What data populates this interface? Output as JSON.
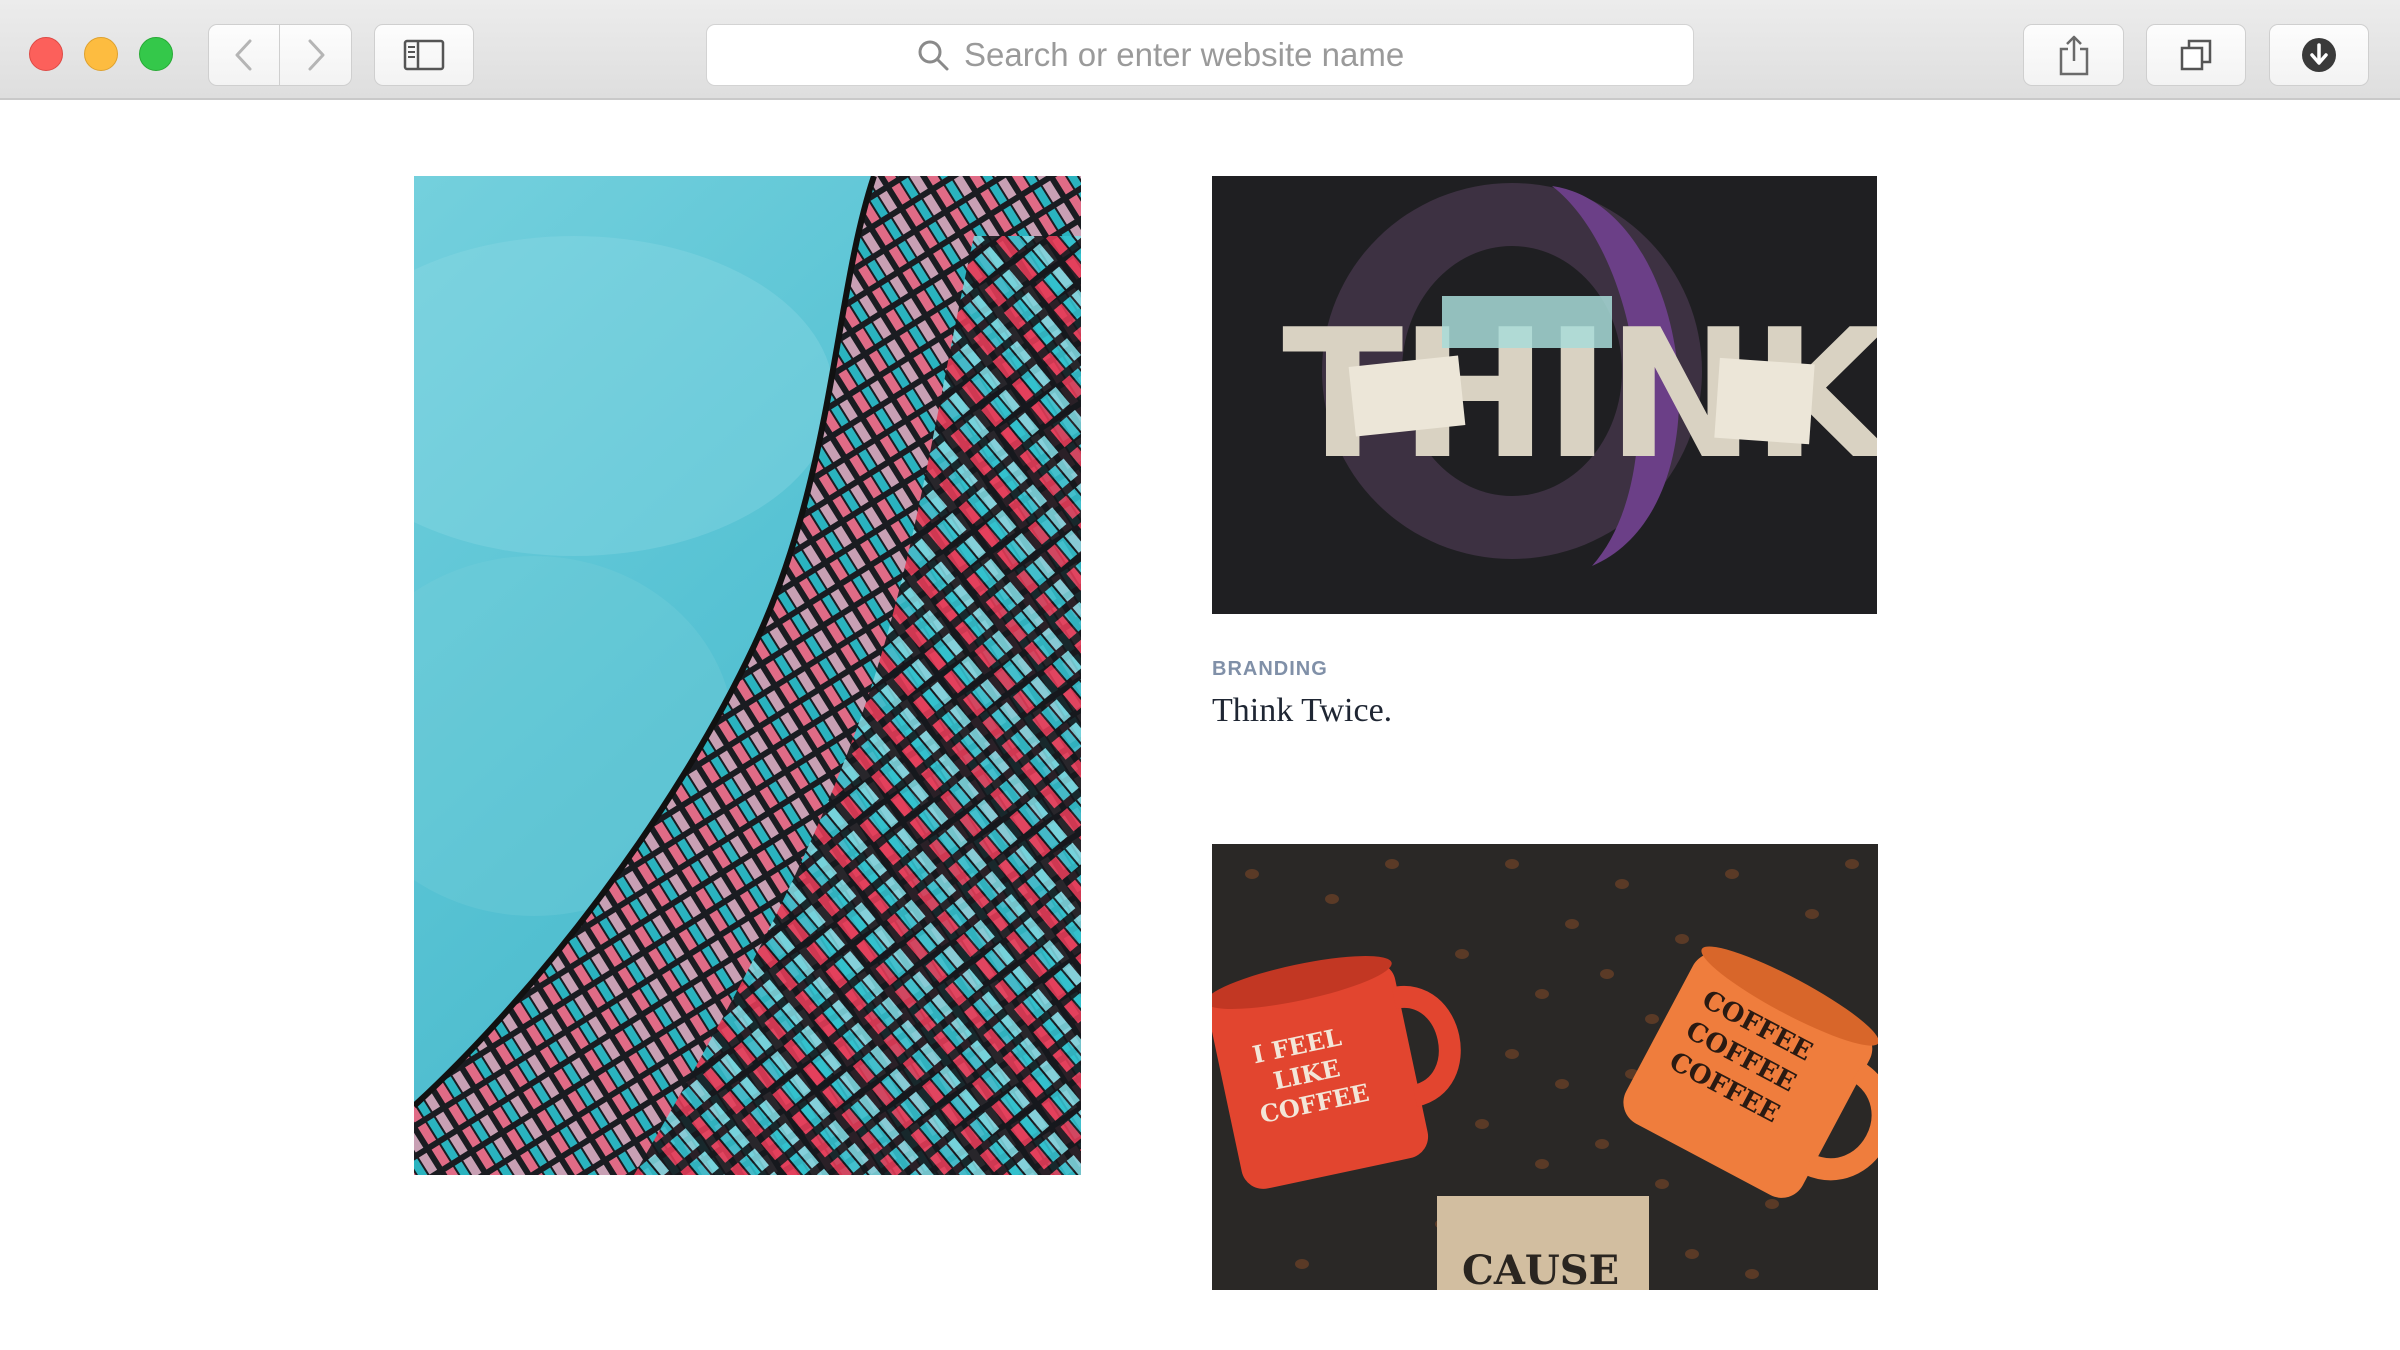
{
  "browser": {
    "address_placeholder": "Search or enter website name",
    "traffic_lights": {
      "close": "#fc605b",
      "minimize": "#fdbc40",
      "maximize": "#34c84a"
    },
    "toolbar_buttons": [
      "back",
      "forward",
      "sidebar",
      "share",
      "tabs",
      "downloads"
    ]
  },
  "posts": [
    {
      "image": "colorful-curved-building-facade"
    },
    {
      "image": "think-twice-lettering",
      "category": "BRANDING",
      "title": "Think Twice."
    },
    {
      "image": "coffee-mugs-and-beans"
    }
  ],
  "artwork": {
    "think_letters": "THINK",
    "mug_left": [
      "I FEEL",
      "LIKE",
      "COFFEE"
    ],
    "mug_right": [
      "COFFEE",
      "COFFEE",
      "COFFEE"
    ],
    "bag": "CAUSE"
  },
  "colors": {
    "sky": "#5fc6d6",
    "category_text": "#8090a8",
    "title_text": "#1f2633"
  }
}
